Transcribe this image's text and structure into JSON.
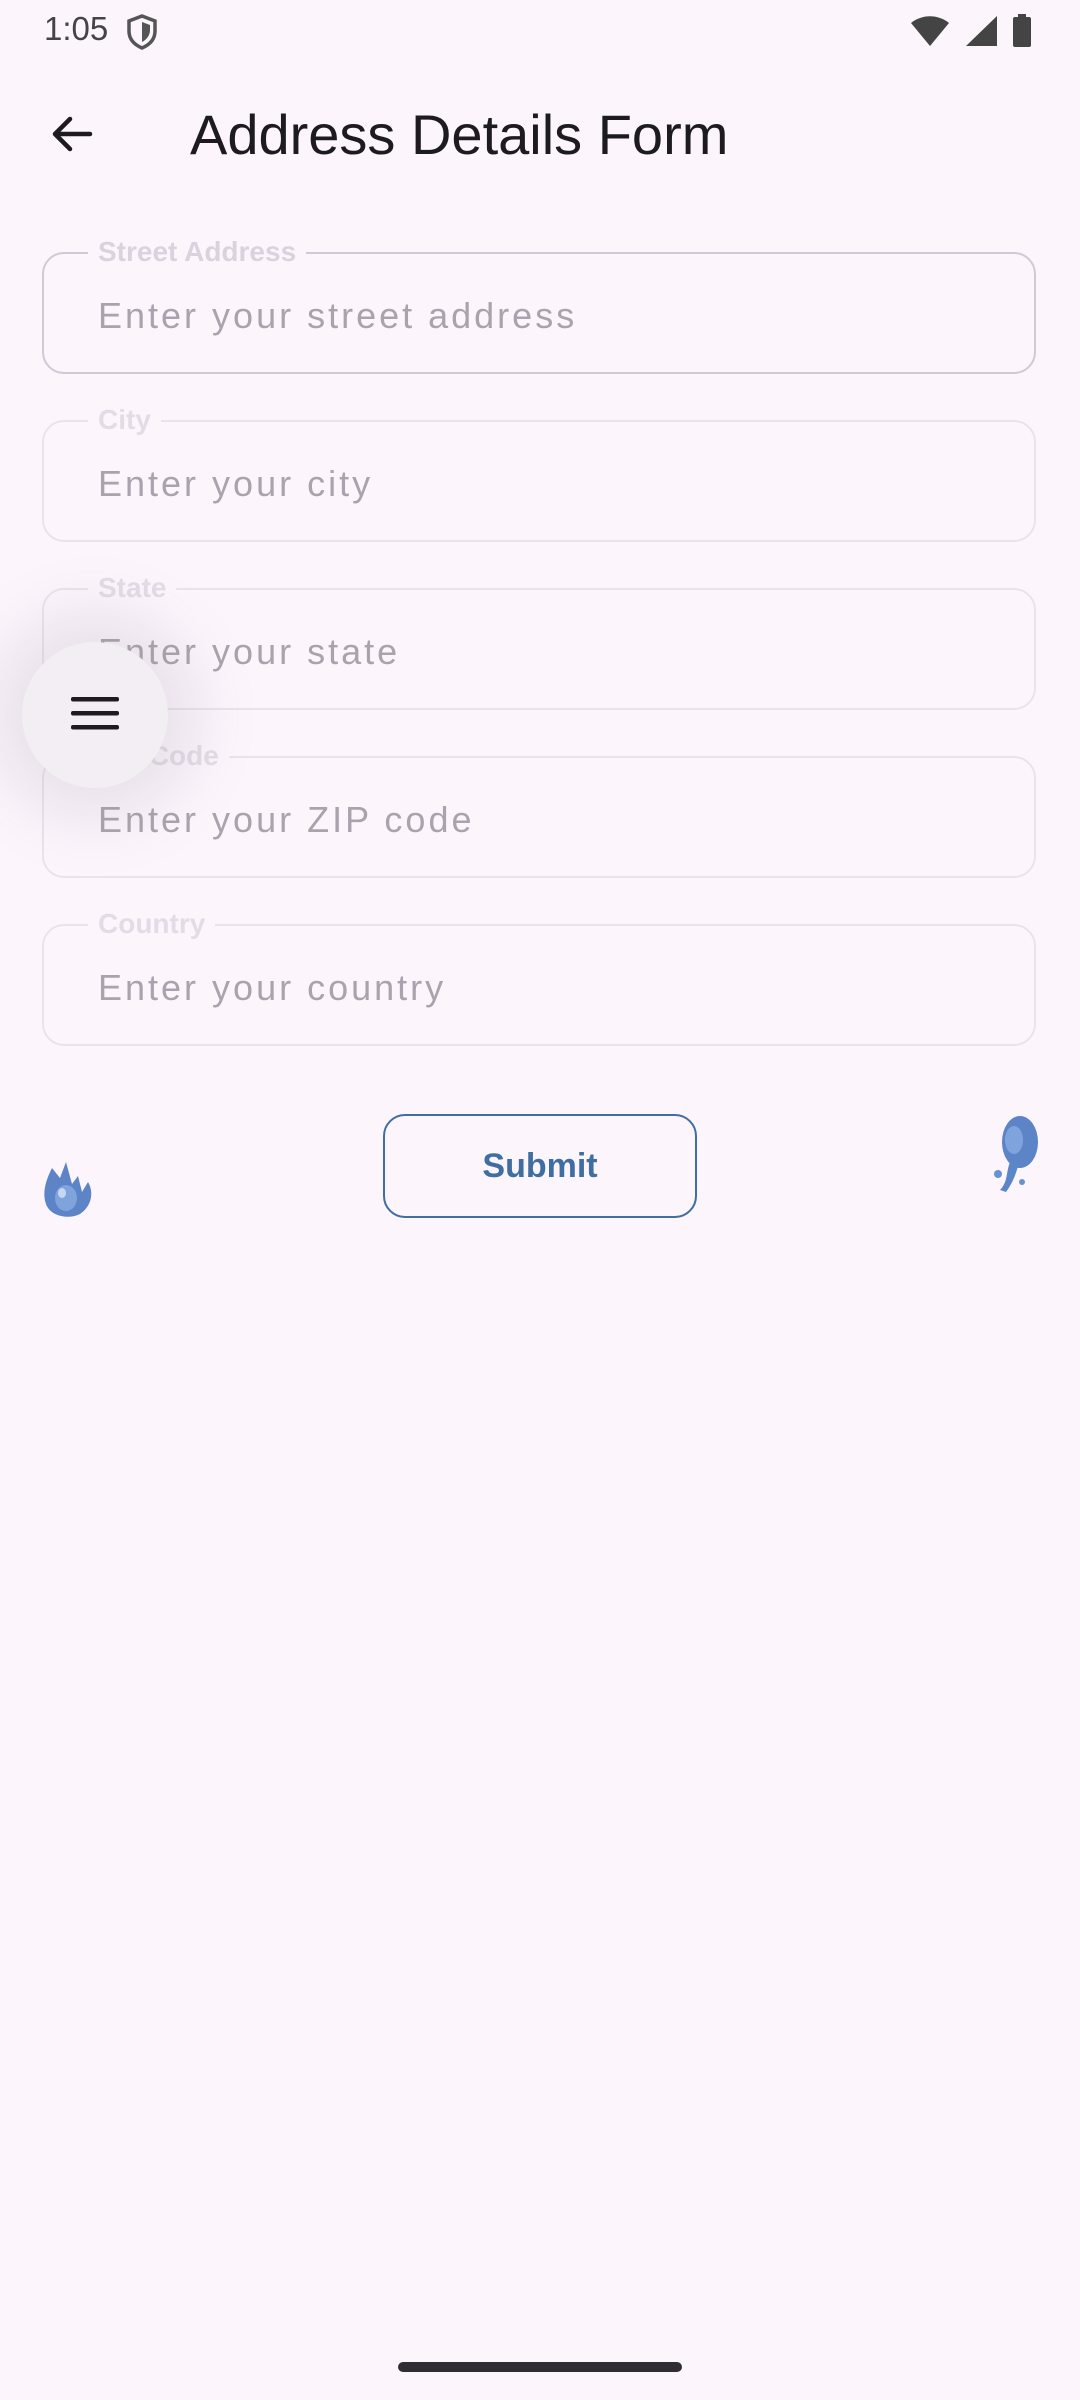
{
  "status_bar": {
    "time": "1:05"
  },
  "app_bar": {
    "title": "Address Details Form"
  },
  "form": {
    "fields": [
      {
        "label": "Street Address",
        "placeholder": "Enter your street address",
        "value": ""
      },
      {
        "label": "City",
        "placeholder": "Enter your city",
        "value": ""
      },
      {
        "label": "State",
        "placeholder": "Enter your state",
        "value": ""
      },
      {
        "label": "ZIP Code",
        "placeholder": "Enter your ZIP code",
        "value": ""
      },
      {
        "label": "Country",
        "placeholder": "Enter your country",
        "value": ""
      }
    ],
    "submit_label": "Submit"
  },
  "icons": {
    "back": "arrow-back-icon",
    "menu": "hamburger-menu-icon",
    "shield": "shield-icon",
    "wifi": "wifi-icon",
    "signal": "signal-icon",
    "battery": "battery-icon"
  },
  "colors": {
    "background": "#fcf5fc",
    "accent": "#3f6ea3",
    "field_border": "#eae3ec",
    "placeholder": "#aaa3ad"
  }
}
